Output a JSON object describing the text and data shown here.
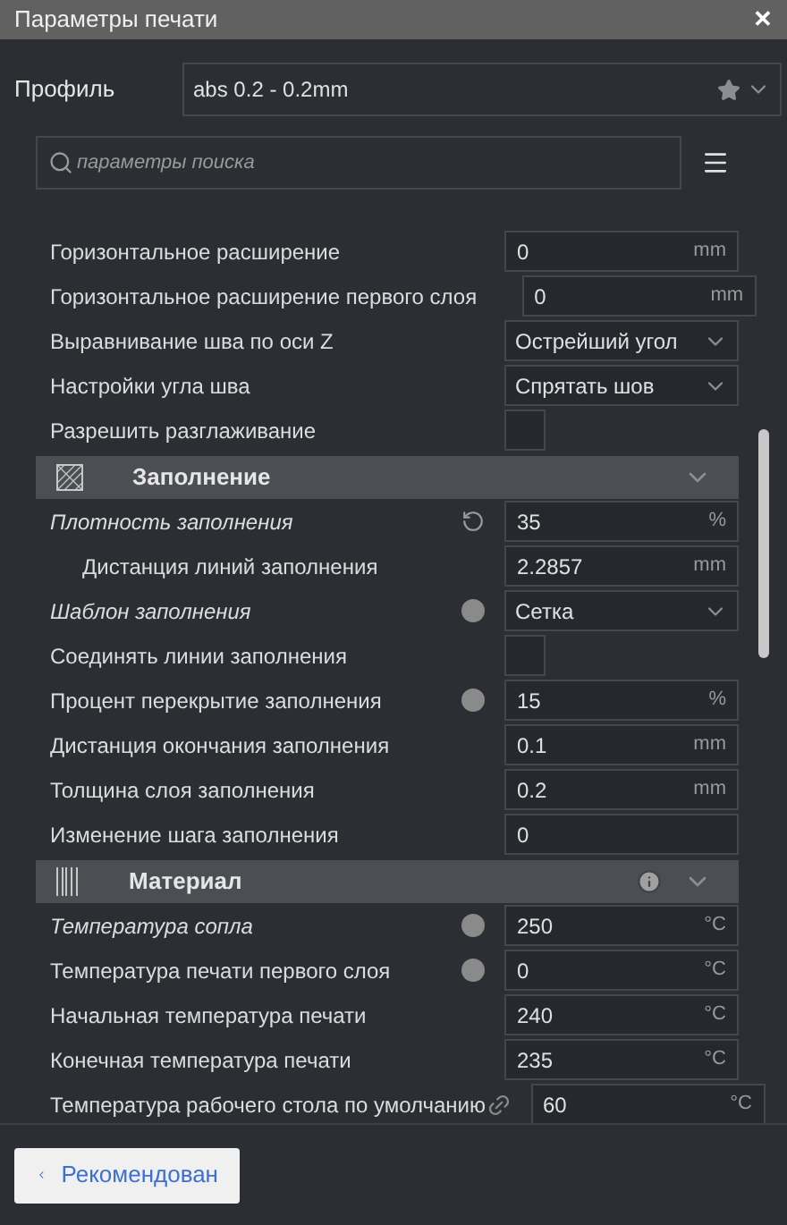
{
  "window": {
    "title": "Параметры печати",
    "close": "✕"
  },
  "profile": {
    "label": "Профиль",
    "value": "abs 0.2 - 0.2mm"
  },
  "search": {
    "placeholder": "параметры поиска"
  },
  "settings": [
    {
      "kind": "number",
      "label": "Горизонтальное расширение",
      "modified": false,
      "value": "0",
      "unit": "mm"
    },
    {
      "kind": "number",
      "label": "Горизонтальное расширение первого слоя",
      "modified": false,
      "value": "0",
      "unit": "mm"
    },
    {
      "kind": "dropdown",
      "label": "Выравнивание шва по оси Z",
      "modified": false,
      "value": "Острейший угол"
    },
    {
      "kind": "dropdown",
      "label": "Настройки угла шва",
      "modified": false,
      "value": "Спрятать шов"
    },
    {
      "kind": "checkbox",
      "label": "Разрешить разглаживание",
      "modified": false,
      "checked": false
    },
    {
      "kind": "infill_header",
      "label": "Заполнение",
      "info": false,
      "expanded": true
    },
    {
      "kind": "number",
      "label": "Плотность заполнения",
      "modified": true,
      "resettable": true,
      "value": "35",
      "unit": "%",
      "children": [
        {
          "kind": "number",
          "label": "Дистанция линий заполнения",
          "modified": false,
          "value": "2.2857",
          "unit": "mm"
        }
      ]
    },
    {
      "kind": "dropdown",
      "label": "Шаблон заполнения",
      "modified": true,
      "formula": true,
      "value": "Сетка"
    },
    {
      "kind": "checkbox",
      "label": "Соединять линии заполнения",
      "modified": false,
      "checked": false
    },
    {
      "kind": "number",
      "label": "Процент перекрытие заполнения",
      "modified": false,
      "formula": true,
      "value": "15",
      "unit": "%"
    },
    {
      "kind": "number",
      "label": "Дистанция окончания заполнения",
      "modified": false,
      "value": "0.1",
      "unit": "mm"
    },
    {
      "kind": "number",
      "label": "Толщина слоя заполнения",
      "modified": false,
      "value": "0.2",
      "unit": "mm"
    },
    {
      "kind": "number",
      "label": "Изменение шага заполнения",
      "modified": false,
      "value": "0"
    },
    {
      "kind": "material_header",
      "label": "Материал",
      "info": true,
      "expanded": true
    },
    {
      "kind": "number",
      "label": "Температура сопла",
      "modified": true,
      "formula": true,
      "value": "250",
      "unit": "°C"
    },
    {
      "kind": "number",
      "label": "Температура печати первого слоя",
      "modified": false,
      "formula": true,
      "value": "0",
      "unit": "°C"
    },
    {
      "kind": "number",
      "label": "Начальная температура печати",
      "modified": false,
      "value": "240",
      "unit": "°C"
    },
    {
      "kind": "number",
      "label": "Конечная температура печати",
      "modified": false,
      "value": "235",
      "unit": "°C"
    },
    {
      "kind": "number",
      "label": "Температура рабочего стола по умолчанию",
      "modified": false,
      "linked": true,
      "value": "60",
      "unit": "°C"
    }
  ],
  "footer": {
    "button": "Рекомендован"
  }
}
